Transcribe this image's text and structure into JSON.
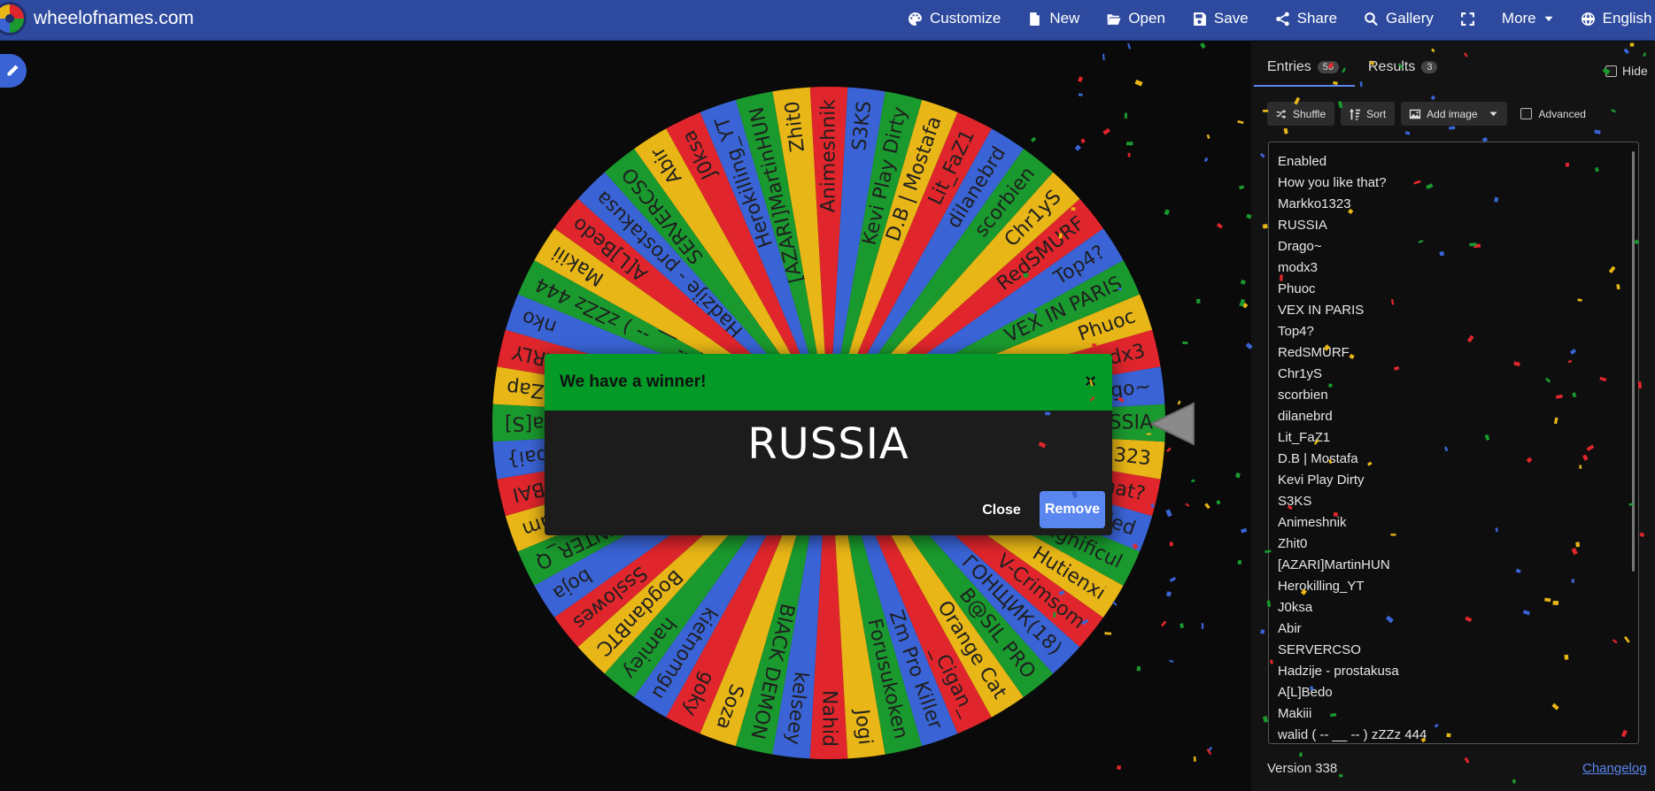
{
  "header": {
    "site_name": "wheelofnames.com",
    "nav": [
      {
        "icon": "palette-icon",
        "label": "Customize"
      },
      {
        "icon": "new-file-icon",
        "label": "New"
      },
      {
        "icon": "folder-open-icon",
        "label": "Open"
      },
      {
        "icon": "save-icon",
        "label": "Save"
      },
      {
        "icon": "share-icon",
        "label": "Share"
      },
      {
        "icon": "search-icon",
        "label": "Gallery"
      },
      {
        "icon": "fullscreen-icon",
        "label": ""
      },
      {
        "icon": "chevron-down-icon",
        "label": "More"
      },
      {
        "icon": "globe-icon",
        "label": "English"
      }
    ],
    "bar_color": "#2d4a9e"
  },
  "wheel": {
    "colors": [
      "#e8b616",
      "#1a9a2e",
      "#3a64d6",
      "#e0262c"
    ],
    "segments": [
      "Enabled",
      "How you like that?",
      "Markko1323",
      "RUSSIA",
      "Drago~",
      "modx3",
      "Phuoc",
      "VEX IN PARIS",
      "Top4?",
      "RedSMURF",
      "Chr1yS",
      "scorbien",
      "dilanebrd",
      "Lit_FaZ1",
      "D.B | Mostafa",
      "Kevi Play Dirty",
      "S3KS",
      "Animeshnik",
      "Zhit0",
      "[AZARI]MartinHUN",
      "Herokilling_YT",
      "J0ksa",
      "Abir",
      "SERVERCSO",
      "Hadzije - prostakusa",
      "A[L]Bedo",
      "Makiii",
      "walid ( -- __ -- ) zZZz 444",
      "nko",
      "ARLY",
      "iusZap",
      "ora[S]",
      "{inpai}",
      "RUBAI",
      "Arham",
      "ITZ_HUNTER_Q",
      "boja",
      "Ssslowes",
      "BogdanBTC",
      "hamiey",
      "kietnomgu",
      "goky",
      "Soza",
      "BlACK DEMON",
      "kelseey",
      "Nahid",
      "Jogi",
      "Forusukoken",
      "Zm Pro Killer",
      "_Cigan_",
      "Orange Cat",
      "B@SIL PRO",
      "ГОНЩИК(18)",
      "V-Crimsom",
      "Hutienxi",
      "shaggy magnificul"
    ]
  },
  "modal": {
    "title": "We have a winner!",
    "close_symbol": "×",
    "winner": "RUSSIA",
    "close_label": "Close",
    "remove_label": "Remove",
    "header_color": "#039a28",
    "remove_color": "#5a86f0"
  },
  "sidebar": {
    "tabs": [
      {
        "label": "Entries",
        "count": "56"
      },
      {
        "label": "Results",
        "count": "3"
      }
    ],
    "hide_label": "Hide",
    "toolbar": {
      "shuffle": "Shuffle",
      "sort": "Sort",
      "add_image": "Add image",
      "advanced": "Advanced"
    },
    "entries": [
      "Enabled",
      "How you like that?",
      "Markko1323",
      "RUSSIA",
      "Drago~",
      "modx3",
      "Phuoc",
      "VEX IN PARIS",
      "Top4?",
      "RedSMURF",
      "Chr1yS",
      "scorbien",
      "dilanebrd",
      "Lit_FaZ1",
      "D.B | Mostafa",
      "Kevi Play Dirty",
      "S3KS",
      "Animeshnik",
      "Zhit0",
      "[AZARI]MartinHUN",
      "Herokilling_YT",
      "J0ksa",
      "Abir",
      "SERVERCSO",
      "Hadzije - prostakusa",
      "A[L]Bedo",
      "Makiii",
      "walid ( -- __ -- ) zZZz 444"
    ],
    "version": "Version 338",
    "changelog": "Changelog"
  }
}
